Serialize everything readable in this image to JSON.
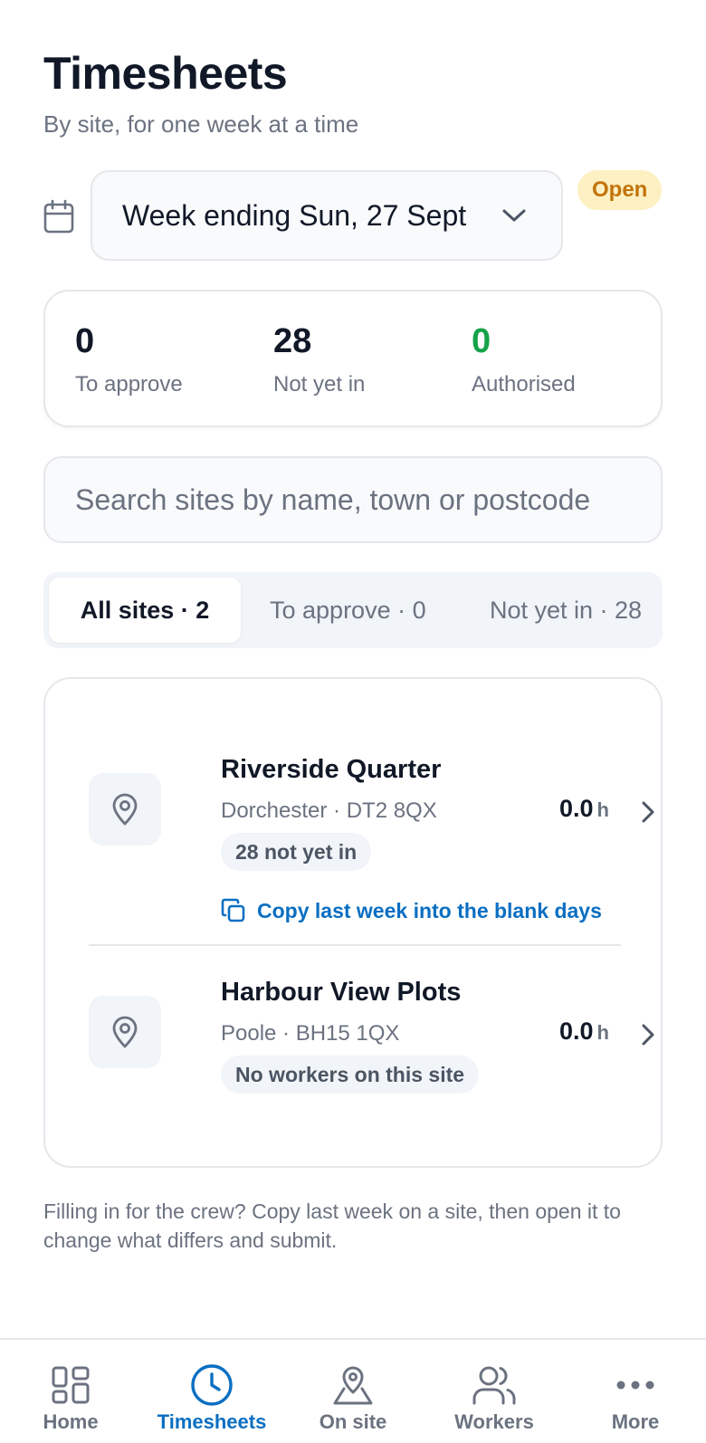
{
  "header": {
    "title": "Timesheets",
    "subtitle": "By site, for one week at a time"
  },
  "week": {
    "icon": "calendar-icon",
    "label": "Week ending Sun, 27 Sept",
    "status": "Open",
    "status_color": "#c2730a"
  },
  "stats": [
    {
      "value": "0",
      "label": "To approve"
    },
    {
      "value": "28",
      "label": "Not yet in"
    },
    {
      "value": "0",
      "label": "Authorised",
      "color": "#16a34a"
    }
  ],
  "search": {
    "placeholder": "Search sites by name, town or postcode",
    "value": ""
  },
  "tabs": [
    {
      "label": "All sites · 2",
      "active": true
    },
    {
      "label": "To approve · 0",
      "active": false
    },
    {
      "label": "Not yet in · 28",
      "active": false
    }
  ],
  "sites": [
    {
      "name": "Riverside Quarter",
      "address": "Dorchester · DT2 8QX",
      "chip": "28 not yet in",
      "hours": "0.0",
      "unit": "h",
      "action": "Copy last week into the blank days"
    },
    {
      "name": "Harbour View Plots",
      "address": "Poole · BH15 1QX",
      "chip": "No workers on this site",
      "hours": "0.0",
      "unit": "h"
    }
  ],
  "hint": "Filling in for the crew? Copy last week on a site, then open it to change what differs and submit.",
  "nav": [
    {
      "label": "Home",
      "icon": "grid-icon",
      "active": false
    },
    {
      "label": "Timesheets",
      "icon": "clock-icon",
      "active": true
    },
    {
      "label": "On site",
      "icon": "map-pin-icon",
      "active": false
    },
    {
      "label": "Workers",
      "icon": "users-icon",
      "active": false
    },
    {
      "label": "More",
      "icon": "more-dots-icon",
      "active": false
    }
  ],
  "colors": {
    "accent": "#0a6fc2",
    "open_badge_bg": "#fdf0c2",
    "authorised": "#16a34a"
  }
}
